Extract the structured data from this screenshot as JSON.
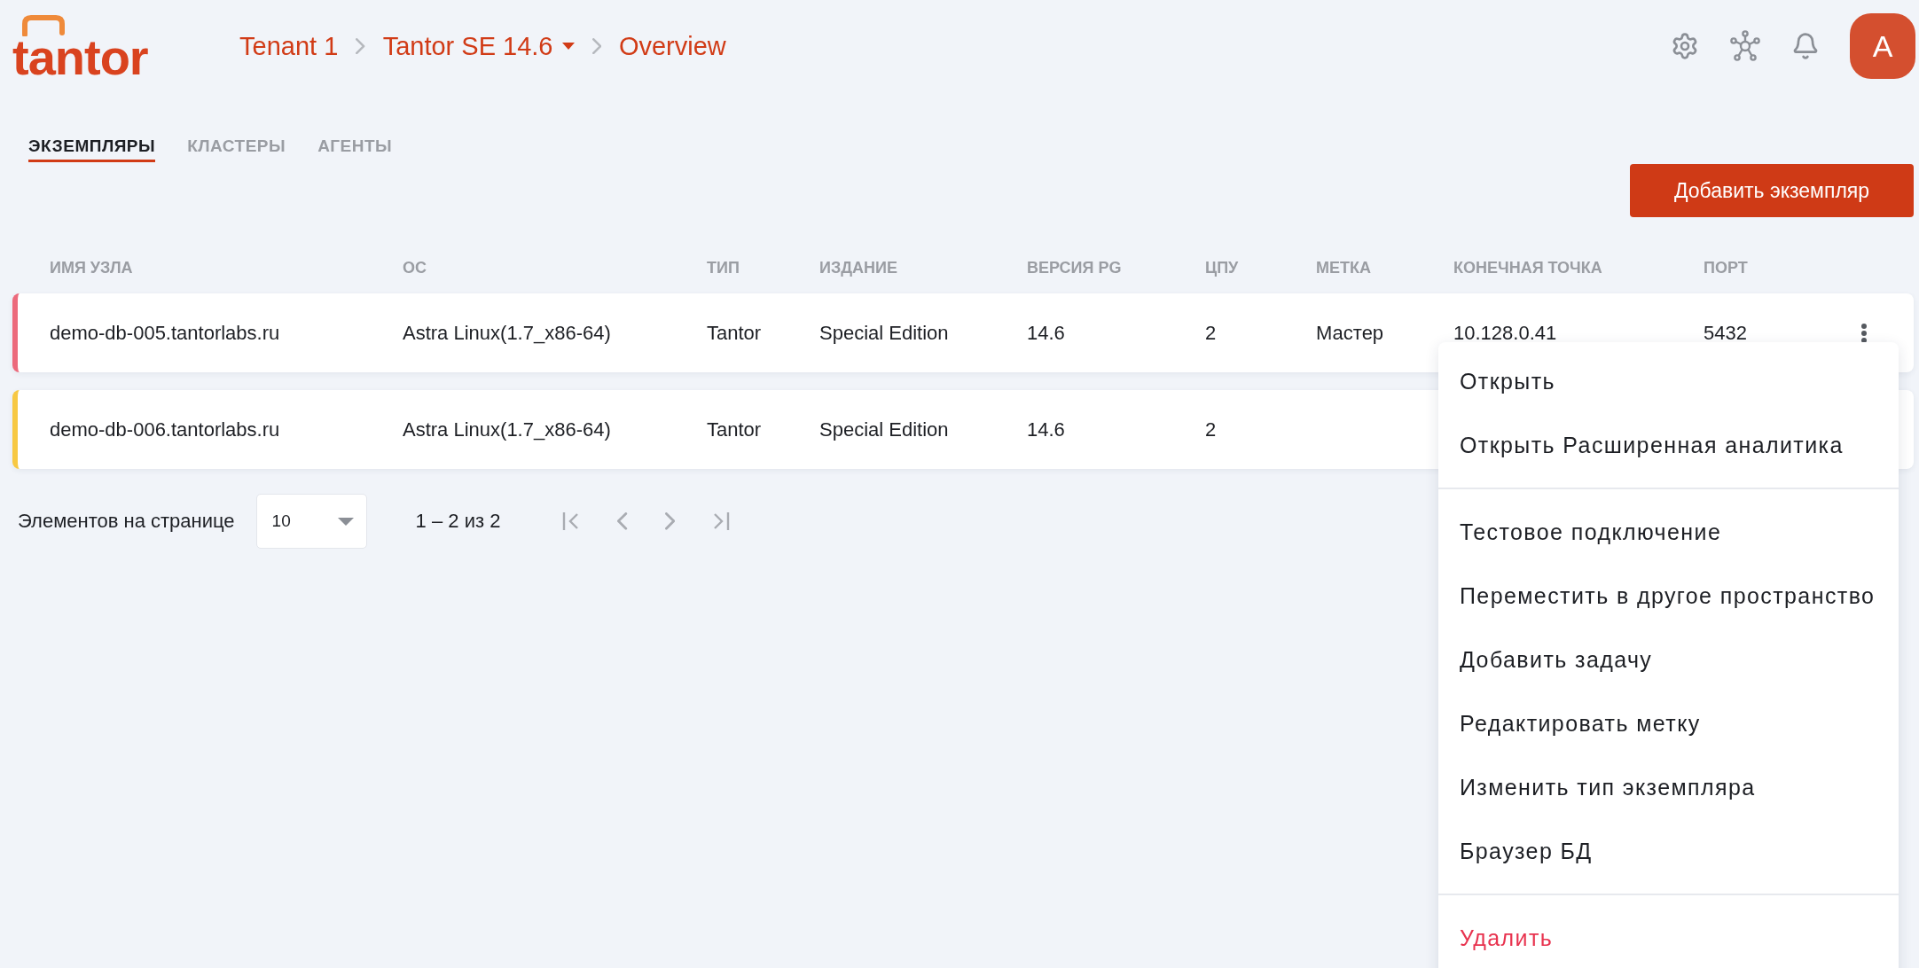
{
  "logo": {
    "text": "tantor"
  },
  "breadcrumbs": [
    {
      "label": "Tenant 1",
      "dropdown": false
    },
    {
      "label": "Tantor SE 14.6",
      "dropdown": true
    },
    {
      "label": "Overview",
      "dropdown": false
    }
  ],
  "user": {
    "initial": "A"
  },
  "tabs": [
    {
      "label": "ЭКЗЕМПЛЯРЫ",
      "selected": true
    },
    {
      "label": "КЛАСТЕРЫ",
      "selected": false
    },
    {
      "label": "АГЕНТЫ",
      "selected": false
    }
  ],
  "add_button": "Добавить экземпляр",
  "table": {
    "columns": [
      "ИМЯ УЗЛА",
      "ОС",
      "ТИП",
      "ИЗДАНИЕ",
      "ВЕРСИЯ PG",
      "ЦПУ",
      "МЕТКА",
      "КОНЕЧНАЯ ТОЧКА",
      "ПОРТ"
    ],
    "rows": [
      {
        "color": "#ec6a7c",
        "cells": [
          "demo-db-005.tantorlabs.ru",
          "Astra Linux(1.7_x86-64)",
          "Tantor",
          "Special Edition",
          "14.6",
          "2",
          "Мастер",
          "10.128.0.41",
          "5432"
        ]
      },
      {
        "color": "#f7c843",
        "cells": [
          "demo-db-006.tantorlabs.ru",
          "Astra Linux(1.7_x86-64)",
          "Tantor",
          "Special Edition",
          "14.6",
          "2"
        ]
      }
    ]
  },
  "pagination": {
    "label": "Элементов на странице",
    "page_size": "10",
    "range": "1 – 2 из 2",
    "buttons": [
      {
        "kind": "first",
        "disabled": true
      },
      {
        "kind": "prev",
        "disabled": true
      },
      {
        "kind": "next",
        "disabled": true
      },
      {
        "kind": "last",
        "disabled": true
      }
    ]
  },
  "context_menu": {
    "groups": [
      [
        {
          "label": "Открыть",
          "danger": false
        },
        {
          "label": "Открыть Расширенная аналитика",
          "danger": false
        }
      ],
      [
        {
          "label": "Тестовое подключение",
          "danger": false
        },
        {
          "label": "Переместить в другое пространство",
          "danger": false
        },
        {
          "label": "Добавить задачу",
          "danger": false
        },
        {
          "label": "Редактировать метку",
          "danger": false
        },
        {
          "label": "Изменить тип экземпляра",
          "danger": false
        },
        {
          "label": "Браузер БД",
          "danger": false
        }
      ],
      [
        {
          "label": "Удалить",
          "danger": true
        }
      ]
    ]
  }
}
